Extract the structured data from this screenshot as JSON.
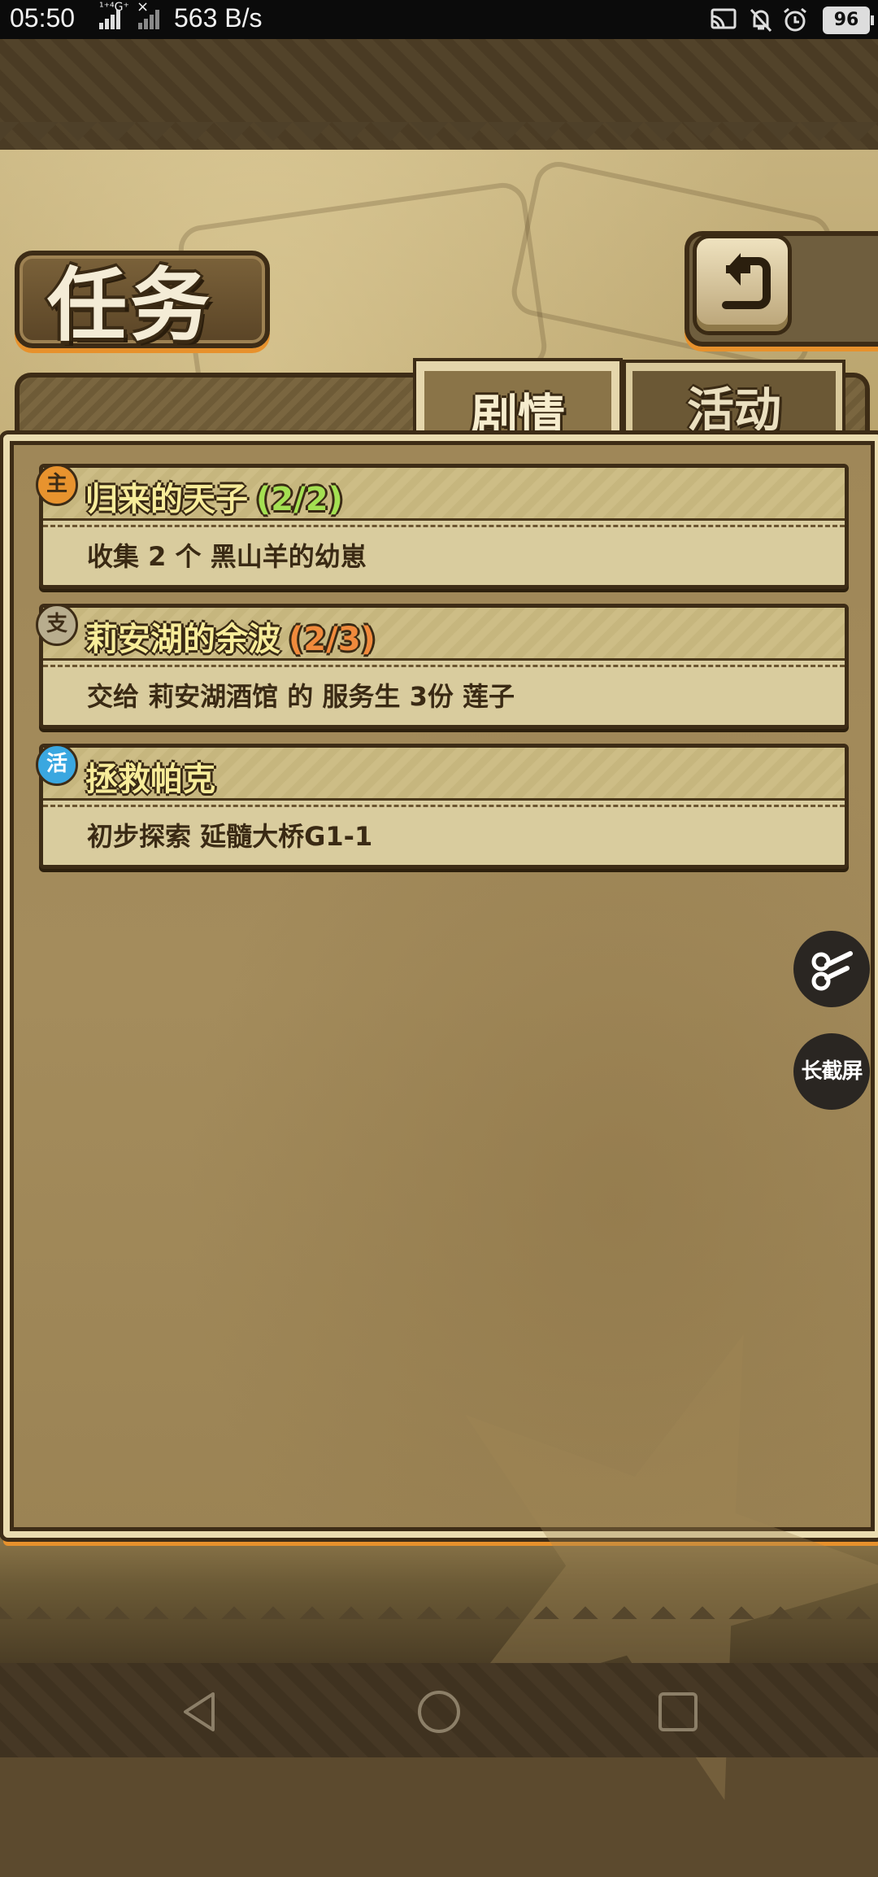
{
  "status_bar": {
    "time": "05:50",
    "signal_label": "¹⁺⁴G⁺",
    "x_mark": "×",
    "speed": "563 B/s",
    "battery": "96",
    "icons": [
      "cast-icon",
      "bell-muted-icon",
      "alarm-icon",
      "battery-icon"
    ]
  },
  "header": {
    "title": "任务",
    "back_icon": "return-arrow-icon"
  },
  "tabs": [
    {
      "label": "剧情",
      "active": true
    },
    {
      "label": "活动",
      "active": false
    }
  ],
  "quests": [
    {
      "badge": "主",
      "badge_color": "#e8932e",
      "title": "归来的天子",
      "progress": "(2/2)",
      "progress_color": "#a4e052",
      "desc": "收集 2 个 黑山羊的幼崽"
    },
    {
      "badge": "支",
      "badge_color": "#b8ad8e",
      "title": "莉安湖的余波",
      "progress": "(2/3)",
      "progress_color": "#f08a3c",
      "desc": "交给 莉安湖酒馆 的 服务生 3份 莲子"
    },
    {
      "badge": "活",
      "badge_color": "#3aa7e0",
      "title": "拯救帕克",
      "progress": "",
      "progress_color": "",
      "desc": "初步探索 延髓大桥G1-1"
    }
  ],
  "floating": {
    "scissors_icon": "scissors-icon",
    "long_screenshot": "长截屏"
  },
  "navigation": [
    "back-triangle-icon",
    "home-circle-icon",
    "recents-square-icon"
  ]
}
